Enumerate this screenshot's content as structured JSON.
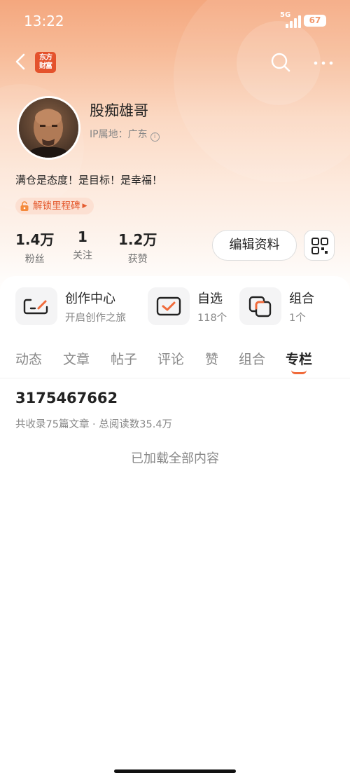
{
  "status_bar": {
    "time": "13:22",
    "network": "5G",
    "battery": "67"
  },
  "nav": {
    "app_logo_line1": "东方",
    "app_logo_line2": "财富"
  },
  "profile": {
    "username": "股痴雄哥",
    "ip_location": "IP属地：广东",
    "bio": "满仓是态度！是目标！是幸福！",
    "milestone": "解锁里程碑"
  },
  "stats": [
    {
      "value": "1.4万",
      "label": "粉丝"
    },
    {
      "value": "1",
      "label": "关注"
    },
    {
      "value": "1.2万",
      "label": "获赞"
    }
  ],
  "edit_profile_label": "编辑资料",
  "features": [
    {
      "title": "创作中心",
      "subtitle": "开启创作之旅"
    },
    {
      "title": "自选",
      "subtitle": "118个"
    },
    {
      "title": "组合",
      "subtitle": "1个"
    }
  ],
  "tabs": [
    "动态",
    "文章",
    "帖子",
    "评论",
    "赞",
    "组合",
    "专栏"
  ],
  "active_tab": "专栏",
  "column": {
    "title": "3175467662",
    "meta": "共收录75篇文章 · 总阅读数35.4万"
  },
  "loaded_all_text": "已加载全部内容",
  "colors": {
    "accent": "#f06a3a",
    "header_top": "#f4a77e"
  }
}
